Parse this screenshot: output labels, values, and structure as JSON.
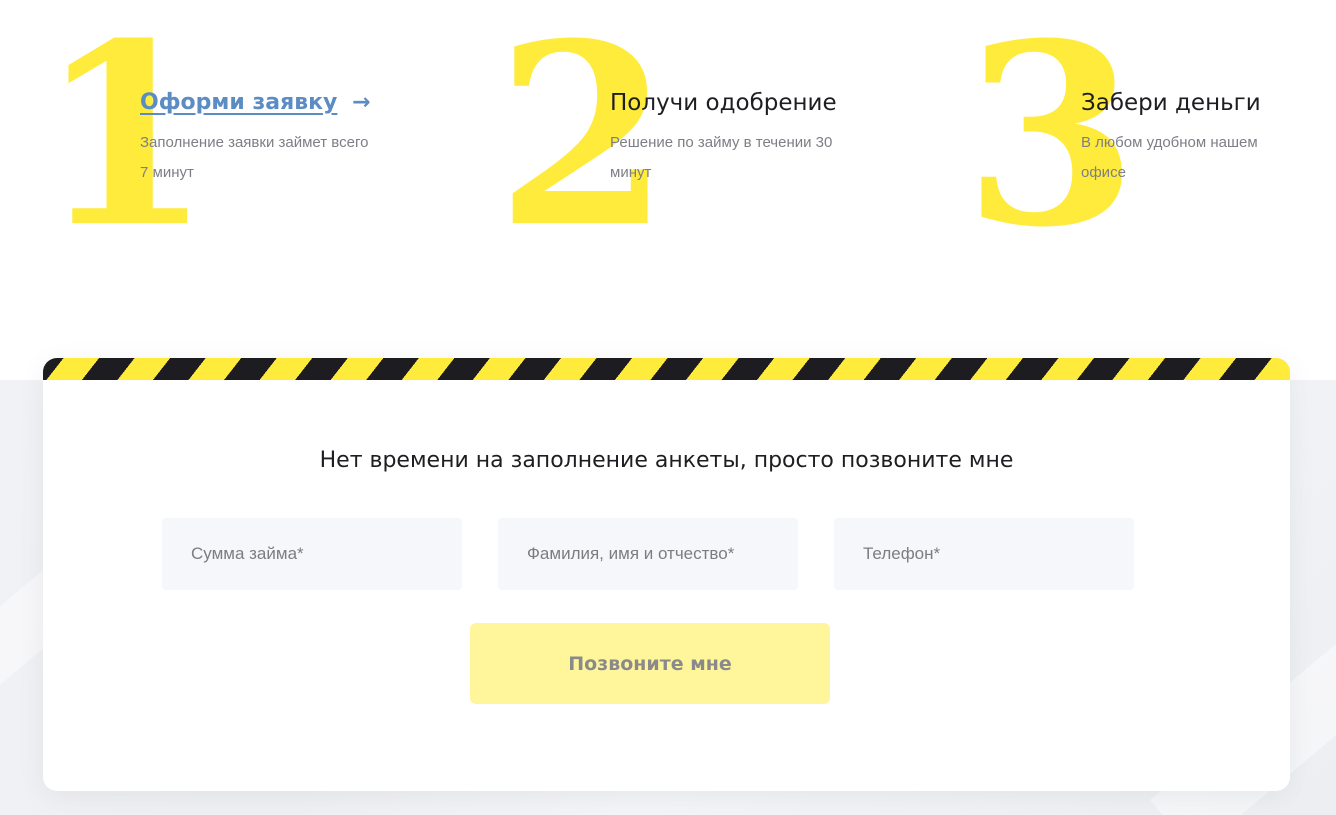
{
  "steps": [
    {
      "number": "1",
      "title": "Оформи заявку",
      "arrow": "→",
      "description": "Заполнение заявки займет всего 7 минут"
    },
    {
      "number": "2",
      "title": "Получи одобрение",
      "description": "Решение по займу в течении 30 минут"
    },
    {
      "number": "3",
      "title": "Забери деньги",
      "description": "В любом удобном нашем офисе"
    }
  ],
  "form": {
    "title": "Нет времени на заполнение анкеты, просто позвоните мне",
    "fields": {
      "amount_placeholder": "Сумма займа*",
      "name_placeholder": "Фамилия, имя и отчество*",
      "phone_placeholder": "Телефон*"
    },
    "submit_label": "Позвоните мне"
  },
  "colors": {
    "accent_yellow": "#ffeb3b",
    "hazard_dark": "#1d1d21",
    "link_blue": "#5b8cc4",
    "button_bg": "#fff59a"
  }
}
